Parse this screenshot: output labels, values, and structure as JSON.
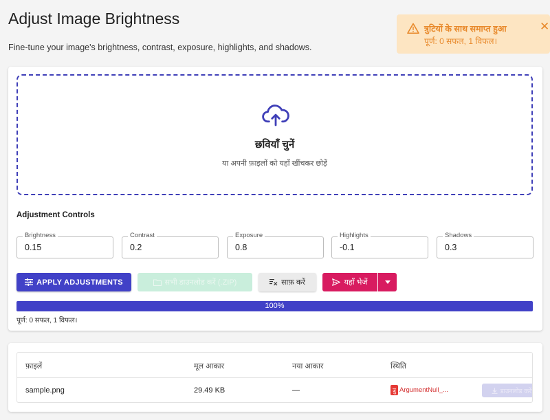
{
  "page": {
    "title": "Adjust Image Brightness",
    "subtitle": "Fine-tune your image's brightness, contrast, exposure, highlights, and shadows."
  },
  "toast": {
    "title": "त्रुटियों के साथ समाप्त हुआ",
    "message": "पूर्ण: 0 सफल, 1 विफल।",
    "color": "#e8892b",
    "background": "#fde5c2",
    "icon": "warning-icon"
  },
  "dropzone": {
    "icon": "cloud-upload-icon",
    "title": "छवियाँ चुनें",
    "subtitle": "या अपनी फ़ाइलों को यहाँ खींचकर छोड़ें"
  },
  "controls": {
    "heading": "Adjustment Controls",
    "fields": [
      {
        "label": "Brightness",
        "value": "0.15"
      },
      {
        "label": "Contrast",
        "value": "0.2"
      },
      {
        "label": "Exposure",
        "value": "0.8"
      },
      {
        "label": "Highlights",
        "value": "-0.1"
      },
      {
        "label": "Shadows",
        "value": "0.3"
      }
    ]
  },
  "actions": {
    "apply": "APPLY ADJUSTMENTS",
    "download_zip": "सभी डाउनलोड करें (.ZIP)",
    "clear": "साफ़ करें",
    "send": "यहाँ भेजें",
    "accent": "#4141c7",
    "send_color": "#d81b60"
  },
  "progress": {
    "percent": 100,
    "label": "100%",
    "status": "पूर्ण: 0 सफल, 1 विफल।"
  },
  "table": {
    "headers": [
      "फ़ाइलें",
      "मूल आकार",
      "नया आकार",
      "स्थिति"
    ],
    "rows": [
      {
        "file": "sample.png",
        "original_size": "29.49 KB",
        "new_size": "—",
        "status_chip": "त्रु",
        "status_text": "ArgumentNull_...",
        "download": "डाउनलोड करें"
      }
    ]
  }
}
